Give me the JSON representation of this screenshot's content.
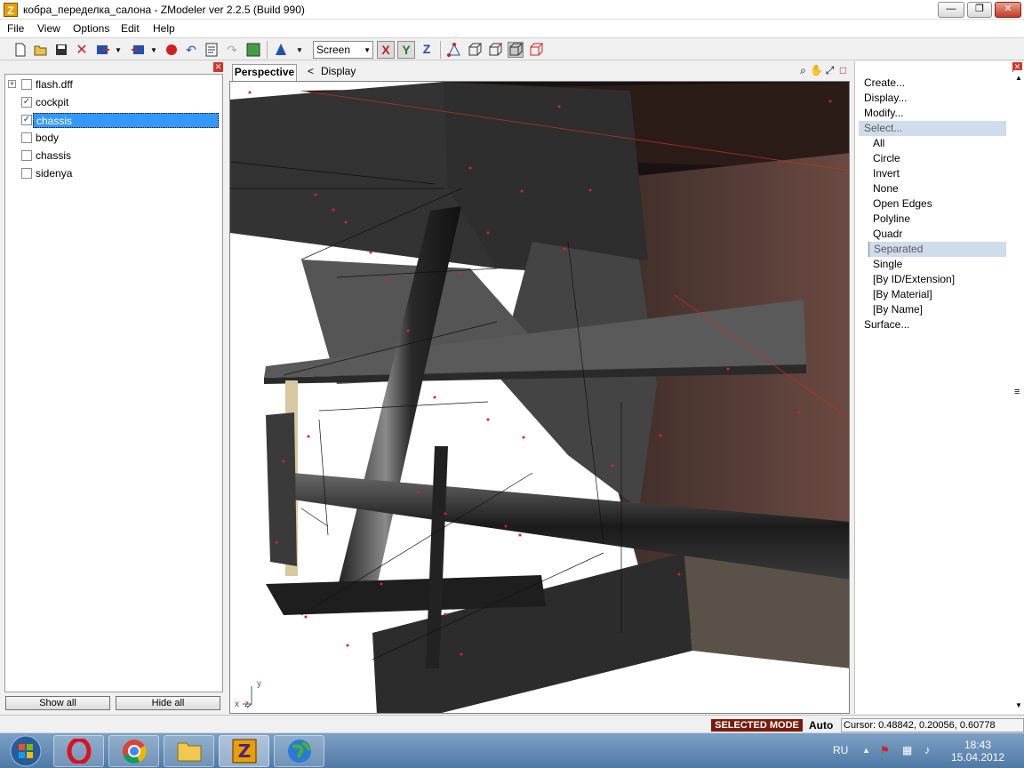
{
  "window": {
    "title": "кобра_переделка_салона - ZModeler ver 2.2.5 (Build 990)",
    "app_icon_letter": "Z",
    "minimize": "—",
    "restore": "❐",
    "close": "✕"
  },
  "menu": [
    "File",
    "View",
    "Options",
    "Edit",
    "Help"
  ],
  "toolbar": {
    "coordinate_mode": "Screen",
    "axes": [
      "X",
      "Y",
      "Z"
    ]
  },
  "scene_tree": {
    "items": [
      {
        "label": "flash.dff",
        "checked": false,
        "expander": "+"
      },
      {
        "label": "cockpit",
        "checked": true
      },
      {
        "label": "chassis",
        "checked": true,
        "selected": true
      },
      {
        "label": "body",
        "checked": false
      },
      {
        "label": "chassis",
        "checked": false
      },
      {
        "label": "sidenya",
        "checked": false
      }
    ],
    "show_all": "Show all",
    "hide_all": "Hide all"
  },
  "viewport": {
    "tab": "Perspective",
    "back_arrow": "<",
    "mode": "Display",
    "axis_y": "y",
    "axis_x": "x",
    "axis_z": "z"
  },
  "command_panel": {
    "top": [
      "Create...",
      "Display...",
      "Modify..."
    ],
    "select_header": "Select...",
    "select_items": [
      "All",
      "Circle",
      "Invert",
      "None",
      "Open Edges",
      "Polyline",
      "Quadr",
      "Separated",
      "Single",
      "[By ID/Extension]",
      "[By Material]",
      "[By Name]"
    ],
    "selected_item": "Separated",
    "bottom": "Surface..."
  },
  "status": {
    "mode": "SELECTED MODE",
    "snap": "Auto",
    "cursor": "Cursor: 0.48842, 0.20056, 0.60778"
  },
  "taskbar": {
    "lang": "RU",
    "time": "18:43",
    "date": "15.04.2012"
  },
  "colors": {
    "selection": "#3399ff",
    "status_mode_bg": "#7a1a0a",
    "panel_highlight": "#cfdcec",
    "close_button": "#c43b24"
  }
}
